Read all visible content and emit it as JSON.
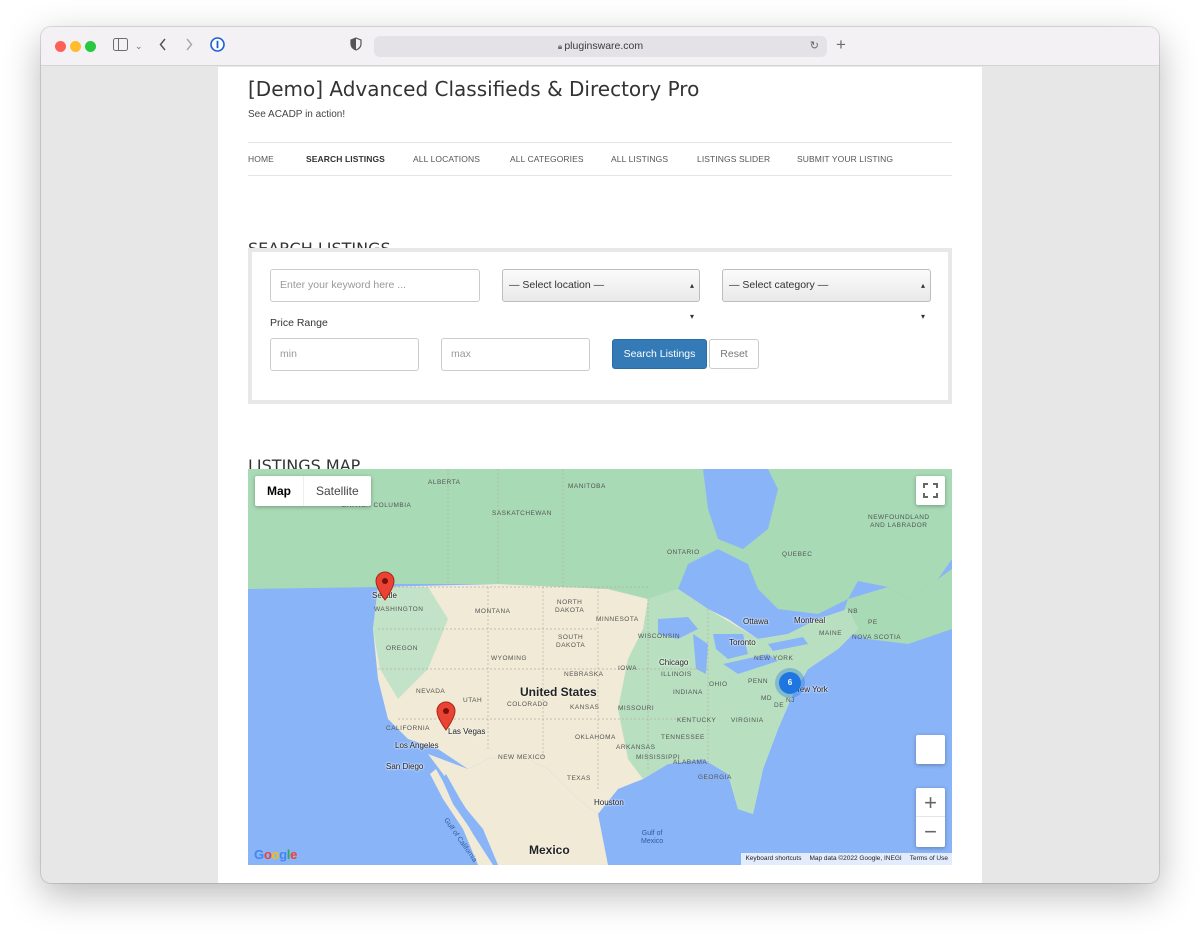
{
  "browser": {
    "url": "pluginsware.com"
  },
  "site": {
    "title": "[Demo] Advanced Classifieds & Directory Pro",
    "tagline": "See ACADP in action!"
  },
  "nav": {
    "items": [
      {
        "label": "HOME",
        "active": false
      },
      {
        "label": "SEARCH LISTINGS",
        "active": true
      },
      {
        "label": "ALL LOCATIONS",
        "active": false
      },
      {
        "label": "ALL CATEGORIES",
        "active": false
      },
      {
        "label": "ALL LISTINGS",
        "active": false
      },
      {
        "label": "LISTINGS SLIDER",
        "active": false
      },
      {
        "label": "SUBMIT YOUR LISTING",
        "active": false
      }
    ]
  },
  "search": {
    "heading": "SEARCH LISTINGS",
    "keyword_placeholder": "Enter your keyword here ...",
    "location_selected": "— Select location —",
    "category_selected": "— Select category —",
    "price_range_label": "Price Range",
    "min_placeholder": "min",
    "max_placeholder": "max",
    "search_button": "Search Listings",
    "reset_button": "Reset"
  },
  "map": {
    "heading": "LISTINGS MAP",
    "type_map": "Map",
    "type_satellite": "Satellite",
    "zoom_in": "+",
    "zoom_out": "−",
    "fullscreen_icon": "fullscreen-icon",
    "attribution": {
      "shortcuts": "Keyboard shortcuts",
      "data": "Map data ©2022 Google, INEGI",
      "terms": "Terms of Use"
    },
    "google_logo": "Google",
    "regions": {
      "alberta": "ALBERTA",
      "manitoba": "MANITOBA",
      "british_columbia": "BRITISH\nCOLUMBIA",
      "saskatchewan": "SASKATCHEWAN",
      "newfoundland": "NEWFOUNDLAND\nAND LABRADOR",
      "ontario": "ONTARIO",
      "quebec": "QUEBEC",
      "washington": "WASHINGTON",
      "north_dakota": "NORTH\nDAKOTA",
      "montana": "MONTANA",
      "minnesota": "MINNESOTA",
      "south_dakota": "SOUTH\nDAKOTA",
      "oregon": "OREGON",
      "wisconsin": "WISCONSIN",
      "wyoming": "WYOMING",
      "iowa": "IOWA",
      "nebraska": "NEBRASKA",
      "nevada": "NEVADA",
      "utah": "UTAH",
      "colorado": "COLORADO",
      "kansas": "KANSAS",
      "missouri": "MISSOURI",
      "illinois": "ILLINOIS",
      "indiana": "INDIANA",
      "ohio": "OHIO",
      "penn": "PENN",
      "new_york": "NEW YORK",
      "california": "CALIFORNIA",
      "kentucky": "KENTUCKY",
      "virginia": "VIRGINIA",
      "oklahoma": "OKLAHOMA",
      "tennessee": "TENNESSEE",
      "arkansas": "ARKANSAS",
      "new_mexico": "NEW MEXICO",
      "mississippi": "MISSISSIPPI",
      "texas": "TEXAS",
      "alabama": "ALABAMA",
      "georgia": "GEORGIA",
      "nb": "NB",
      "maine": "MAINE",
      "nova_scotia": "NOVA SCOTIA",
      "md": "MD",
      "de": "DE",
      "nj": "NJ",
      "pei": "PE"
    },
    "cities": {
      "seattle": "Seattle",
      "ottawa": "Ottawa",
      "montreal": "Montreal",
      "toronto": "Toronto",
      "chicago": "Chicago",
      "new_york": "New York",
      "las_vegas": "Las Vegas",
      "los_angeles": "Los Angeles",
      "san_diego": "San Diego",
      "houston": "Houston"
    },
    "countries": {
      "us": "United States",
      "mexico": "Mexico"
    },
    "water": {
      "gulf_california": "Gulf of California",
      "gulf_mexico": "Gulf of\nMexico"
    },
    "cluster_count": "6",
    "colors": {
      "water": "#8ab4f8",
      "land_green": "#a8dab5",
      "land_tan": "#f0ead6",
      "pin_red": "#ea4335",
      "cluster_blue": "#1f76e0"
    }
  }
}
